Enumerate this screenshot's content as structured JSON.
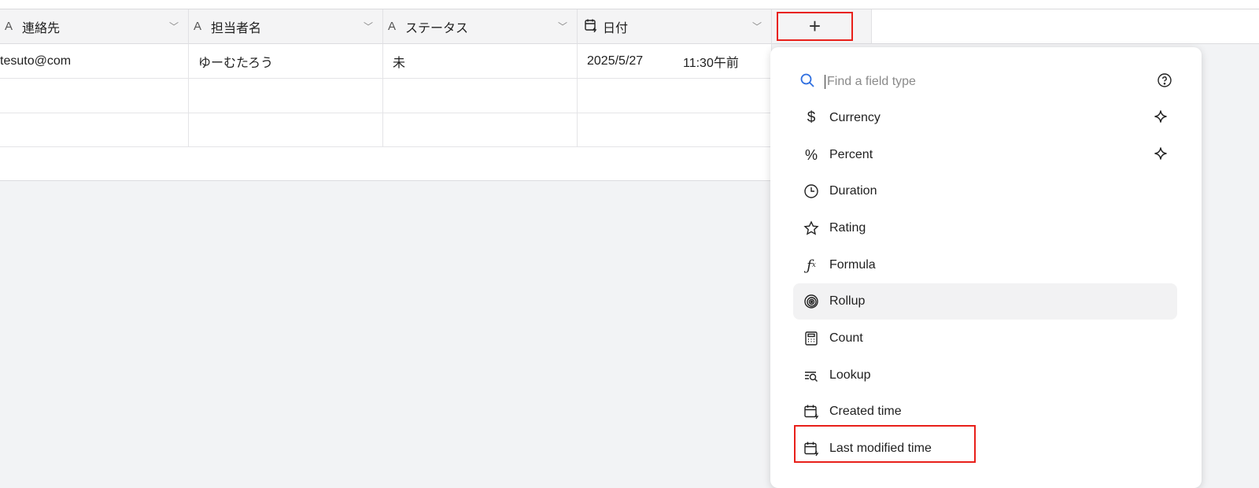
{
  "columns": [
    {
      "label": "連絡先",
      "icon": "text-icon"
    },
    {
      "label": "担当者名",
      "icon": "text-icon"
    },
    {
      "label": "ステータス",
      "icon": "text-icon"
    },
    {
      "label": "日付",
      "icon": "calendar-icon"
    }
  ],
  "text_icon_glyph": "A",
  "add_column_label": "+",
  "rows": [
    [
      "tesuto@com",
      "ゆーむたろう",
      "未",
      "2025/5/27",
      "11:30午前"
    ],
    [
      "",
      "",
      "",
      "",
      ""
    ],
    [
      "",
      "",
      "",
      "",
      ""
    ]
  ],
  "menu": {
    "search_placeholder": "Find a field type",
    "items": [
      {
        "label": "Currency",
        "icon": "dollar-icon",
        "sparkle": true
      },
      {
        "label": "Percent",
        "icon": "percent-icon",
        "sparkle": true
      },
      {
        "label": "Duration",
        "icon": "clock-icon"
      },
      {
        "label": "Rating",
        "icon": "star-icon"
      },
      {
        "label": "Formula",
        "icon": "formula-icon"
      },
      {
        "label": "Rollup",
        "icon": "spiral-icon",
        "highlighted": true
      },
      {
        "label": "Count",
        "icon": "calculator-icon"
      },
      {
        "label": "Lookup",
        "icon": "lookup-icon"
      },
      {
        "label": "Created time",
        "icon": "calendar-icon"
      },
      {
        "label": "Last modified time",
        "icon": "calendar-icon"
      }
    ]
  },
  "colors": {
    "highlight": "#e8201a",
    "search_icon": "#2f6fe0"
  }
}
